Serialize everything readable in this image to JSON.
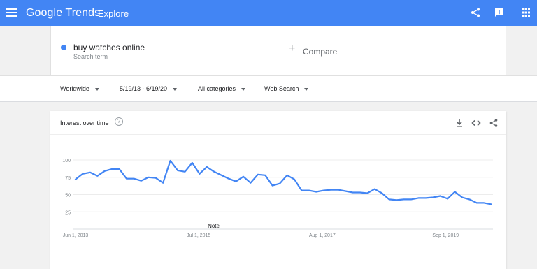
{
  "header": {
    "logo": "Google Trends",
    "section": "Explore",
    "menu_icon": "menu-icon",
    "share_icon": "share-icon",
    "feedback_icon": "feedback-icon",
    "apps_icon": "apps-icon",
    "bar_color": "#4285f4"
  },
  "search": {
    "term": "buy watches online",
    "term_type": "Search term",
    "term_color": "#4285f4",
    "compare_label": "Compare"
  },
  "filters": {
    "region": "Worldwide",
    "date_range": "5/19/13 - 6/19/20",
    "category": "All categories",
    "property": "Web Search"
  },
  "card": {
    "title": "Interest over time",
    "help_icon": "help-icon",
    "download_icon": "download-icon",
    "embed_icon": "embed-icon",
    "share_icon": "share-icon"
  },
  "chart_data": {
    "type": "line",
    "title": "Interest over time",
    "xlabel": "",
    "ylabel": "",
    "ylim": [
      0,
      100
    ],
    "yticks": [
      25,
      50,
      75,
      100
    ],
    "x_tick_labels": [
      {
        "date": "2013-06-01",
        "label": "Jun 1, 2013"
      },
      {
        "date": "2015-07-01",
        "label": "Jul 1, 2015"
      },
      {
        "date": "2017-08-01",
        "label": "Aug 1, 2017"
      },
      {
        "date": "2019-09-01",
        "label": "Sep 1, 2019"
      }
    ],
    "x_range": [
      "2013-05-19",
      "2020-06-19"
    ],
    "grid": true,
    "annotation": {
      "date": "2015-10-01",
      "text": "Note"
    },
    "series": [
      {
        "color": "#4285f4",
        "x": [
          "2013-06-01",
          "2013-07-16",
          "2013-08-30",
          "2013-10-14",
          "2013-11-28",
          "2014-01-12",
          "2014-02-26",
          "2014-04-12",
          "2014-05-27",
          "2014-07-11",
          "2014-08-25",
          "2014-10-09",
          "2014-11-23",
          "2015-01-07",
          "2015-02-21",
          "2015-04-07",
          "2015-05-22",
          "2015-07-06",
          "2015-08-20",
          "2015-10-04",
          "2015-11-18",
          "2016-01-02",
          "2016-02-16",
          "2016-04-01",
          "2016-05-16",
          "2016-06-30",
          "2016-08-14",
          "2016-09-28",
          "2016-11-12",
          "2016-12-27",
          "2017-02-10",
          "2017-03-27",
          "2017-05-11",
          "2017-06-25",
          "2017-08-09",
          "2017-09-23",
          "2017-11-07",
          "2017-12-22",
          "2018-02-05",
          "2018-03-22",
          "2018-05-06",
          "2018-06-20",
          "2018-08-04",
          "2018-09-18",
          "2018-11-02",
          "2018-12-17",
          "2019-01-31",
          "2019-03-17",
          "2019-05-01",
          "2019-06-15",
          "2019-07-30",
          "2019-09-13",
          "2019-10-28",
          "2019-12-12",
          "2020-01-26",
          "2020-03-11",
          "2020-04-25",
          "2020-06-09"
        ],
        "values": [
          72,
          80,
          82,
          77,
          84,
          87,
          87,
          73,
          73,
          70,
          75,
          74,
          67,
          99,
          85,
          83,
          96,
          80,
          90,
          83,
          78,
          73,
          69,
          76,
          67,
          79,
          78,
          63,
          66,
          78,
          72,
          56,
          56,
          54,
          56,
          57,
          57,
          55,
          53,
          53,
          52,
          58,
          52,
          43,
          42,
          43,
          43,
          45,
          45,
          46,
          48,
          44,
          54,
          46,
          43,
          38,
          38,
          36
        ]
      }
    ]
  }
}
